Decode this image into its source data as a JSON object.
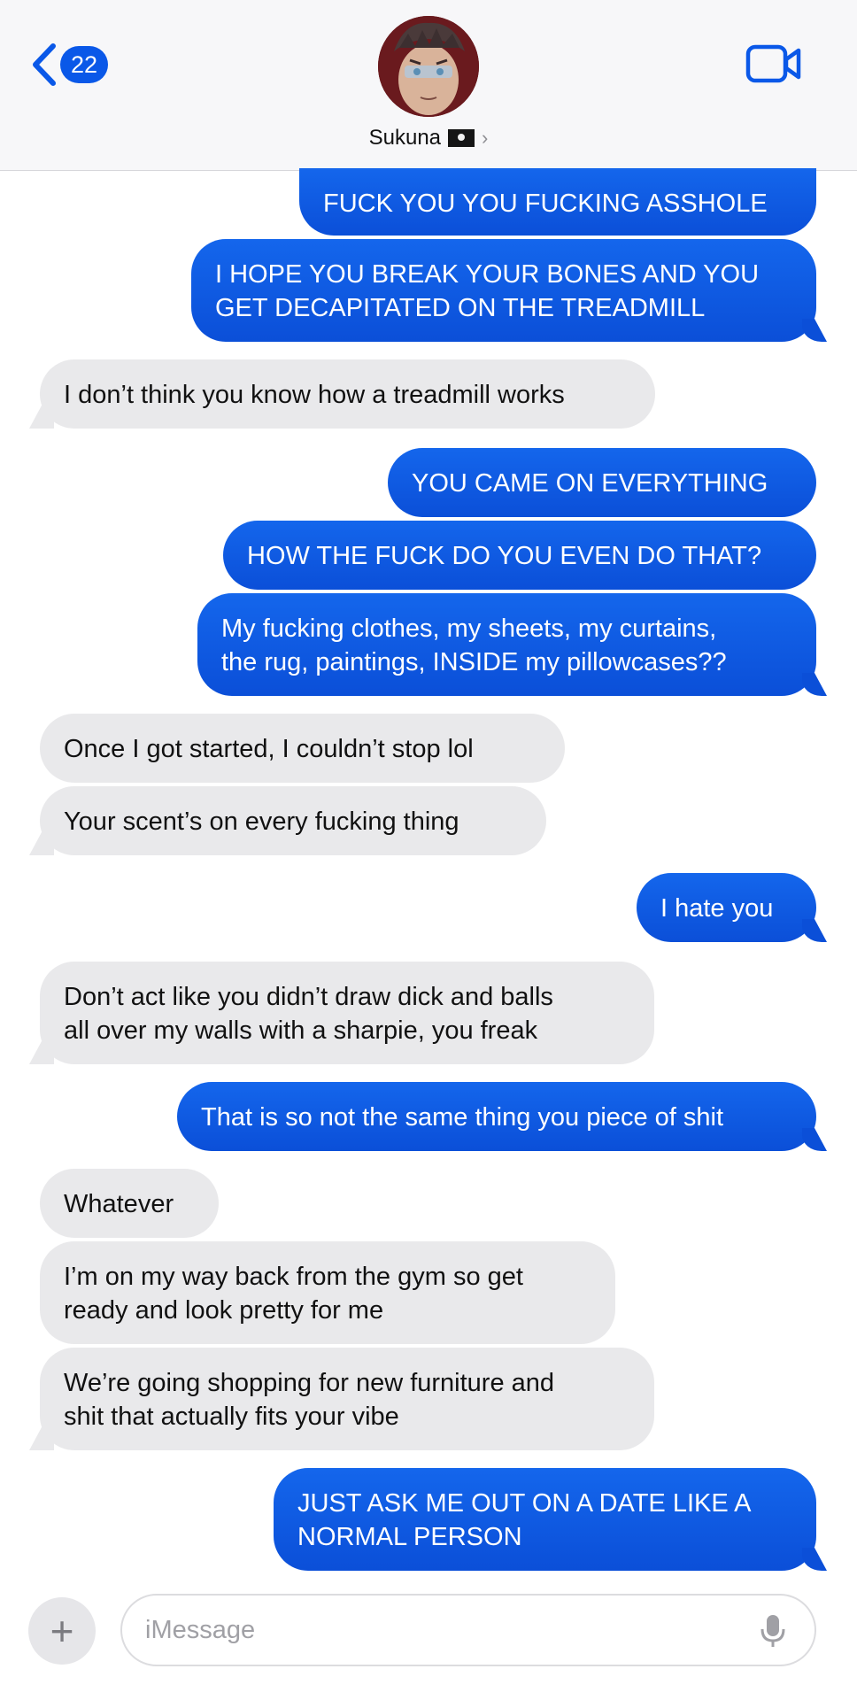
{
  "header": {
    "unread_count": "22",
    "contact_name": "Sukuna",
    "contact_emoji": "pirate-flag",
    "icons": [
      "chevron-left-icon",
      "video-camera-icon",
      "chevron-right-icon"
    ]
  },
  "messages": [
    {
      "from": "me",
      "text_lines": [
        "FUCK YOU YOU FUCKING ASSHOLE"
      ]
    },
    {
      "from": "me",
      "text_lines": [
        "I HOPE YOU BREAK YOUR BONES AND YOU",
        "GET DECAPITATED ON THE TREADMILL"
      ]
    },
    {
      "from": "them",
      "text_lines": [
        "I don’t think you know how a treadmill works"
      ]
    },
    {
      "from": "me",
      "text_lines": [
        "YOU CAME ON EVERYTHING"
      ]
    },
    {
      "from": "me",
      "text_lines": [
        "HOW THE FUCK DO YOU EVEN DO THAT?"
      ]
    },
    {
      "from": "me",
      "text_lines": [
        "My fucking clothes, my sheets, my curtains,",
        "the rug, paintings, INSIDE my pillowcases??"
      ]
    },
    {
      "from": "them",
      "text_lines": [
        "Once I got started, I couldn’t stop lol"
      ]
    },
    {
      "from": "them",
      "text_lines": [
        "Your scent’s on every fucking thing"
      ]
    },
    {
      "from": "me",
      "text_lines": [
        "I hate you"
      ]
    },
    {
      "from": "them",
      "text_lines": [
        "Don’t act like you didn’t draw dick and balls",
        "all over my walls with a sharpie, you freak"
      ]
    },
    {
      "from": "me",
      "text_lines": [
        "That is so not the same thing you piece of shit"
      ]
    },
    {
      "from": "them",
      "text_lines": [
        "Whatever"
      ]
    },
    {
      "from": "them",
      "text_lines": [
        "I’m on my way back from the gym so get",
        "ready and look pretty for me"
      ]
    },
    {
      "from": "them",
      "text_lines": [
        "We’re going shopping for new furniture and",
        "shit that actually fits your vibe"
      ]
    },
    {
      "from": "me",
      "text_lines": [
        "JUST ASK ME OUT ON A DATE LIKE A",
        "NORMAL PERSON"
      ]
    }
  ],
  "composer": {
    "placeholder": "iMessage",
    "plus_label": "+"
  },
  "colors": {
    "sent_bubble": "#0b4fd8",
    "received_bubble": "#e9e9eb",
    "accent": "#0a58e8"
  }
}
